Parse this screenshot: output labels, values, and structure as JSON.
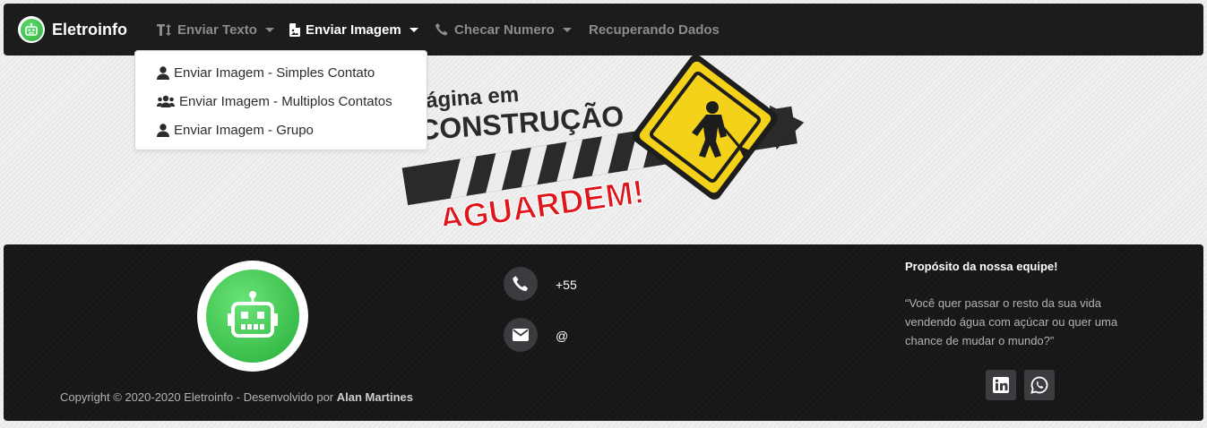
{
  "navbar": {
    "brand": "Eletroinfo",
    "items": [
      {
        "label": "Enviar Texto",
        "icon": "text-height-icon",
        "dropdown": true
      },
      {
        "label": "Enviar Imagem",
        "icon": "file-image-icon",
        "dropdown": true,
        "active": true
      },
      {
        "label": "Checar Numero",
        "icon": "phone-icon",
        "dropdown": true
      },
      {
        "label": "Recuperando Dados"
      }
    ]
  },
  "dropdown": {
    "items": [
      {
        "label": "Enviar Imagem - Simples Contato",
        "icon": "user-icon"
      },
      {
        "label": "Enviar Imagem - Multiplos Contatos",
        "icon": "users-icon"
      },
      {
        "label": "Enviar Imagem - Grupo",
        "icon": "user-icon"
      }
    ]
  },
  "banner": {
    "line1": "ágina em",
    "line2": "CONSTRUÇÃO",
    "line3": "AGUARDEM!"
  },
  "footer": {
    "copyright_prefix": "Copyright © 2020-2020 Eletroinfo - Desenvolvido por",
    "author": "Alan Martines",
    "phone": "+55",
    "email": "@",
    "purpose_title": "Propósito da nossa equipe!",
    "purpose_quote": "“Você quer passar o resto da sua vida vendendo água com açúcar ou quer uma chance de mudar o mundo?”",
    "social": [
      {
        "icon": "linkedin-icon"
      },
      {
        "icon": "whatsapp-icon"
      }
    ]
  },
  "colors": {
    "navbar_bg": "#1c1c1c",
    "brand_green": "#2fb23e",
    "warning_yellow": "#f5d21a",
    "alert_red": "#e0151b"
  }
}
